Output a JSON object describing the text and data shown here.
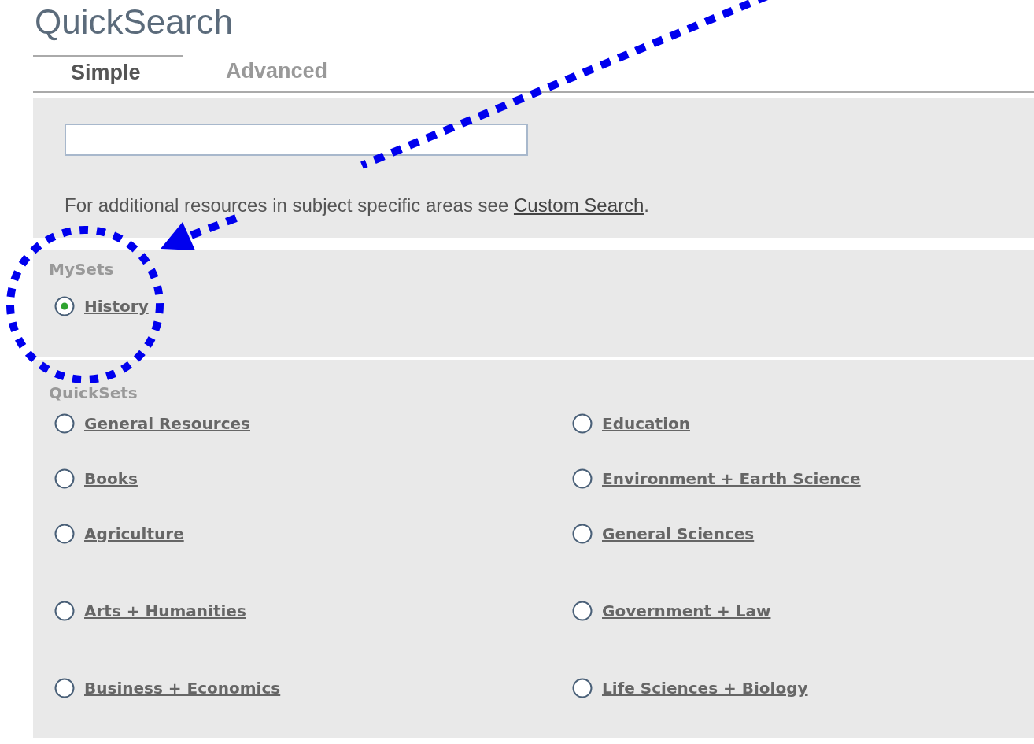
{
  "title": "QuickSearch",
  "tabs": [
    {
      "label": "Simple",
      "selected": true
    },
    {
      "label": "Advanced",
      "selected": false
    }
  ],
  "note": {
    "text": "For additional resources in subject specific areas see ",
    "link": "Custom Search",
    "end": "."
  },
  "mysets": {
    "heading": "MySets",
    "items": [
      {
        "label": "History",
        "selected": true
      }
    ]
  },
  "quicksets": {
    "heading": "QuickSets",
    "items": [
      {
        "label": "General Resources",
        "selected": false
      },
      {
        "label": "Education",
        "selected": false
      },
      {
        "label": "Books",
        "selected": false
      },
      {
        "label": "Environment + Earth Science",
        "selected": false
      },
      {
        "label": "Agriculture",
        "selected": false
      },
      {
        "label": "General Sciences",
        "selected": false
      },
      {
        "label": "Arts + Humanities",
        "selected": false
      },
      {
        "label": "Government + Law",
        "selected": false
      },
      {
        "label": "Business + Economics",
        "selected": false
      },
      {
        "label": "Life Sciences + Biology",
        "selected": false
      }
    ]
  }
}
